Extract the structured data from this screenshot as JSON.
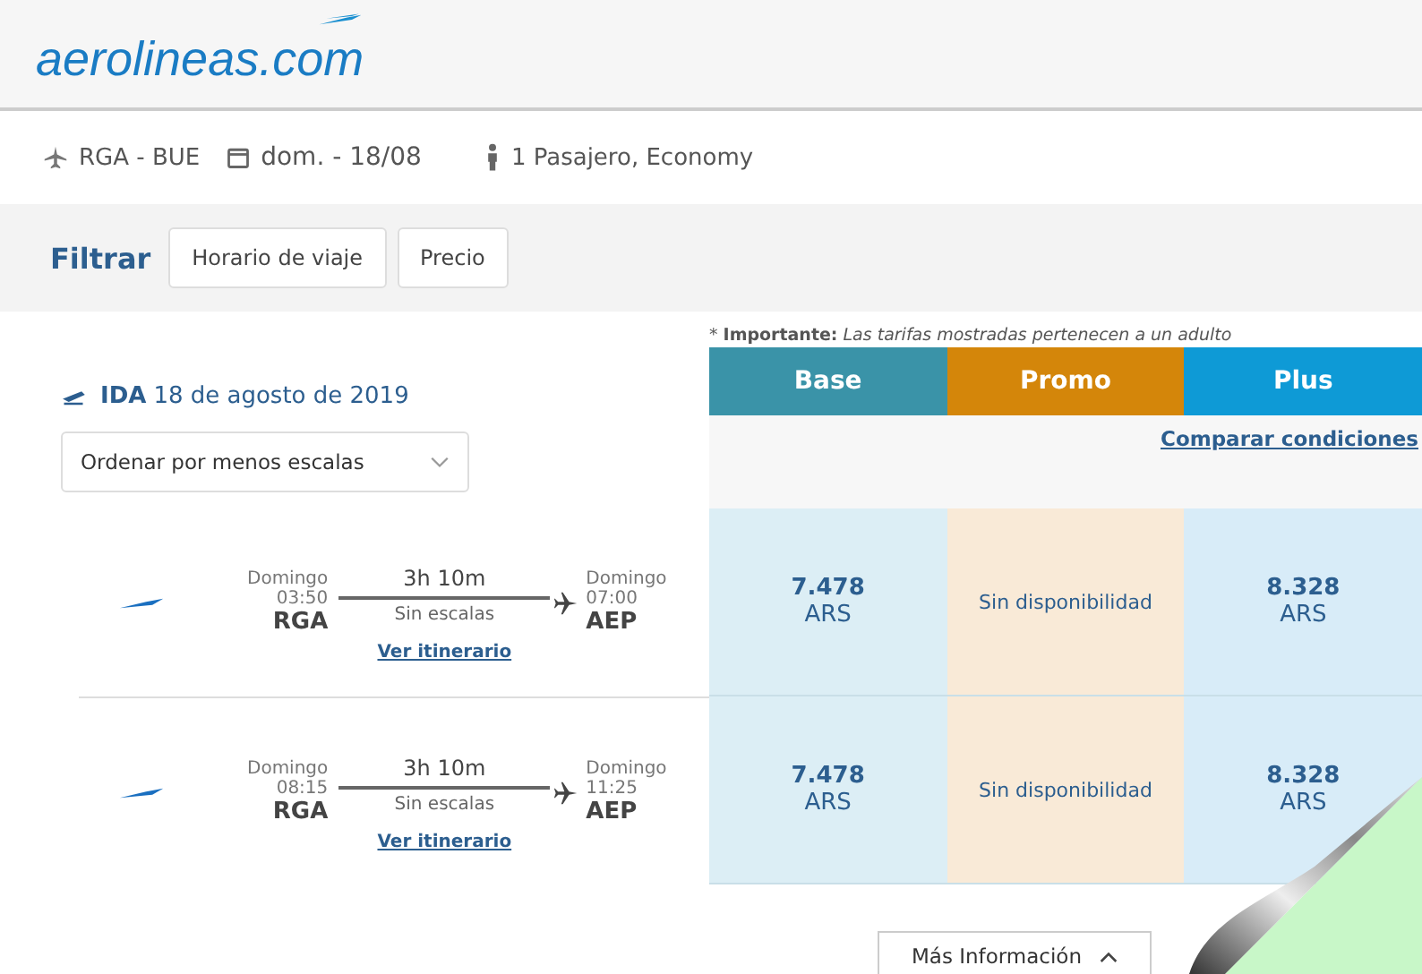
{
  "header": {
    "logo": "aerolineas.com"
  },
  "search_summary": {
    "route": "RGA - BUE",
    "date": "dom. - 18/08",
    "passengers": "1 Pasajero, Economy"
  },
  "filter_bar": {
    "label": "Filtrar",
    "buttons": [
      "Horario de viaje",
      "Precio"
    ]
  },
  "outbound": {
    "label": "IDA",
    "date": "18 de agosto de 2019",
    "sort": "Ordenar por menos escalas"
  },
  "note": "* **Importante:** *Las tarifas mostradas pertenecen a un adulto*",
  "fare_columns": [
    {
      "label": "Base",
      "color": "#3a93a8"
    },
    {
      "label": "Promo",
      "color": "#d4860a"
    },
    {
      "label": "Plus",
      "color": "#0e9ad6"
    }
  ],
  "compare_link": "Comparar condiciones",
  "flights": [
    {
      "departure_day": "Domingo",
      "departure_time": "03:50",
      "departure_airport": "RGA",
      "duration": "3h 10m",
      "stops": "Sin escalas",
      "arrival_day": "Domingo",
      "arrival_time": "07:00",
      "arrival_airport": "AEP",
      "itinerary_link": "Ver itinerario",
      "fares": [
        {
          "kind": "price",
          "amount": "7.478",
          "currency": "ARS"
        },
        {
          "kind": "unavailable",
          "text": "Sin disponibilidad"
        },
        {
          "kind": "price",
          "amount": "8.328",
          "currency": "ARS"
        }
      ]
    },
    {
      "departure_day": "Domingo",
      "departure_time": "08:15",
      "departure_airport": "RGA",
      "duration": "3h 10m",
      "stops": "Sin escalas",
      "arrival_day": "Domingo",
      "arrival_time": "11:25",
      "arrival_airport": "AEP",
      "itinerary_link": "Ver itinerario",
      "fares": [
        {
          "kind": "price",
          "amount": "7.478",
          "currency": "ARS"
        },
        {
          "kind": "unavailable",
          "text": "Sin disponibilidad"
        },
        {
          "kind": "price",
          "amount": "8.328",
          "currency": "ARS"
        }
      ]
    }
  ],
  "more_info_button": "Más Información"
}
